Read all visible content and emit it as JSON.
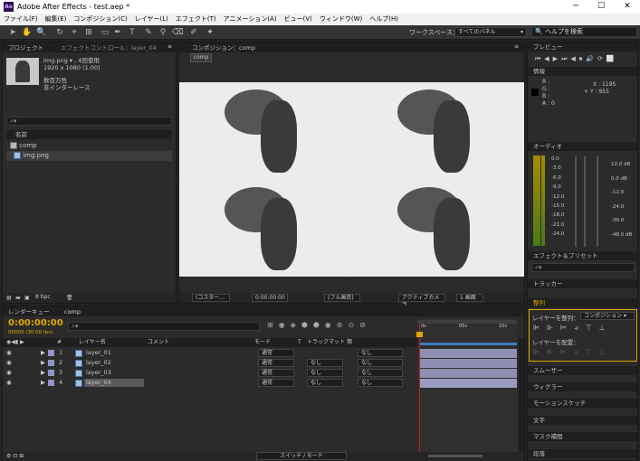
{
  "window": {
    "title": "Adobe After Effects - test.aep *",
    "logo": "Ae"
  },
  "menu": [
    "ファイル(F)",
    "編集(E)",
    "コンポジション(C)",
    "レイヤー(L)",
    "エフェクト(T)",
    "アニメーション(A)",
    "ビュー(V)",
    "ウィンドウ(W)",
    "ヘルプ(H)"
  ],
  "toolbar": {
    "workspace_label": "ワークスペース：",
    "workspace_value": "すべてのパネル",
    "help_search": "ヘルプを検索"
  },
  "project": {
    "tab": "プロジェクト",
    "tab2": "エフェクトコントロール：layer_04",
    "thumb_name": "img.png ▾ , 4回使用",
    "thumb_size": "1920 x 1080 (1.00)",
    "thumb_color": "数百万色",
    "thumb_scan": "非インターレース",
    "col_name": "名前",
    "items": [
      {
        "name": "comp",
        "type": "comp"
      },
      {
        "name": "img.png",
        "type": "image"
      }
    ],
    "bpc": "8 bpc"
  },
  "comp_view": {
    "tab": "コンポジション：comp",
    "comp_label": "comp",
    "footer": {
      "quality": "(フル画質)",
      "time": "0:00:00:00",
      "camera": "アクティブカメラ",
      "views": "1 画面",
      "zoom": "(コスター..."
    }
  },
  "right": {
    "preview": "プレビュー",
    "info": "情報",
    "info_r": "R :",
    "info_g": "G :",
    "info_b": "B :",
    "info_a": "A : 0",
    "info_x": "X : 1195",
    "info_y": "Y : 955",
    "audio": "オーディオ",
    "audio_left": [
      "0.0",
      "-3.0",
      "-6.0",
      "-9.0",
      "-12.0",
      "-15.0",
      "-18.0",
      "-21.0",
      "-24.0"
    ],
    "audio_right": [
      "12.0 dB",
      "0.0 dB",
      "-12.0",
      "-24.0",
      "-36.0",
      "-48.0 dB"
    ],
    "effects": "エフェクト＆プリセット",
    "tracker": "トラッカー",
    "align": "整列",
    "align_to_label": "レイヤーを整列：",
    "align_to_value": "コンポジション",
    "distribute": "レイヤーを配置：",
    "smoother": "スムーザー",
    "wiggler": "ウィグラー",
    "motion_sketch": "モーションスケッチ",
    "character": "文字",
    "mask": "マスク補間",
    "paragraph": "段落"
  },
  "timeline": {
    "tab1": "レンダーキュー",
    "tab2": "comp",
    "timecode": "0:00:00:00",
    "frames": "00000 (30.00 fps)",
    "headers": {
      "num": "#",
      "name": "レイヤー名",
      "comment": "コメント",
      "mode": "モード",
      "t": "T",
      "trkmat": "トラックマット",
      "parent": "親"
    },
    "ruler": [
      "0s",
      "05s",
      "10s"
    ],
    "layers": [
      {
        "num": "1",
        "name": "layer_01",
        "mode": "通常",
        "trk": "",
        "parent": "なし"
      },
      {
        "num": "2",
        "name": "layer_02",
        "mode": "通常",
        "trk": "なし",
        "parent": "なし"
      },
      {
        "num": "3",
        "name": "layer_03",
        "mode": "通常",
        "trk": "なし",
        "parent": "なし"
      },
      {
        "num": "4",
        "name": "layer_04",
        "mode": "通常",
        "trk": "なし",
        "parent": "なし"
      }
    ],
    "footer": "スイッチ / モード"
  },
  "colors": {
    "accent": "#e0a800",
    "layer_bar": "#8e8fb3",
    "playhead": "#c21f1f",
    "work_area": "#3f7cc0"
  }
}
